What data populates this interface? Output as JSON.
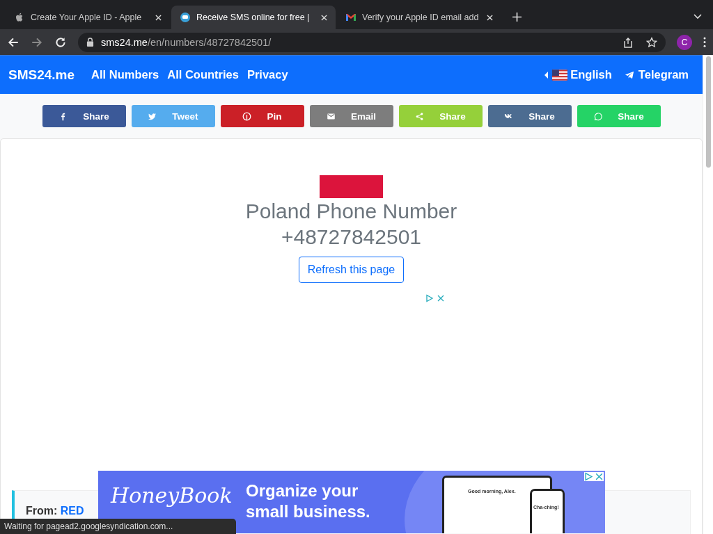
{
  "browser": {
    "tabs": [
      {
        "title": "Create Your Apple ID - Apple",
        "kind": "apple",
        "selected": false
      },
      {
        "title": "Receive SMS online for free |",
        "kind": "chat",
        "selected": true
      },
      {
        "title": "Verify your Apple ID email add",
        "kind": "mail",
        "selected": false
      }
    ],
    "url_host": "sms24.me",
    "url_path": "/en/numbers/48727842501/",
    "profile_initial": "C"
  },
  "navbar": {
    "brand": "SMS24.me",
    "links": [
      "All Numbers",
      "All Countries",
      "Privacy"
    ],
    "language": "English",
    "telegram": "Telegram"
  },
  "share_buttons": [
    {
      "label": "Share",
      "kind": "facebook",
      "color": "#3b5998"
    },
    {
      "label": "Tweet",
      "kind": "twitter",
      "color": "#55acee"
    },
    {
      "label": "Pin",
      "kind": "pinterest",
      "color": "#cb2027"
    },
    {
      "label": "Email",
      "kind": "email",
      "color": "#7d7d7d"
    },
    {
      "label": "Share",
      "kind": "share",
      "color": "#95d03a"
    },
    {
      "label": "Share",
      "kind": "vk",
      "color": "#4c6c91"
    },
    {
      "label": "Share",
      "kind": "whatsapp",
      "color": "#25d366"
    }
  ],
  "number": {
    "title": "Poland Phone Number",
    "phone": "+48727842501",
    "refresh_button": "Refresh this page"
  },
  "message": {
    "from_label": "From:",
    "sender": "RED"
  },
  "ad": {
    "logo": "HoneyBook",
    "headline": "Organize your small business.",
    "greeting": "Good morning, Alex.",
    "phone_text": "Cha-ching!"
  },
  "status_bar": "Waiting for pagead2.googlesyndication.com..."
}
